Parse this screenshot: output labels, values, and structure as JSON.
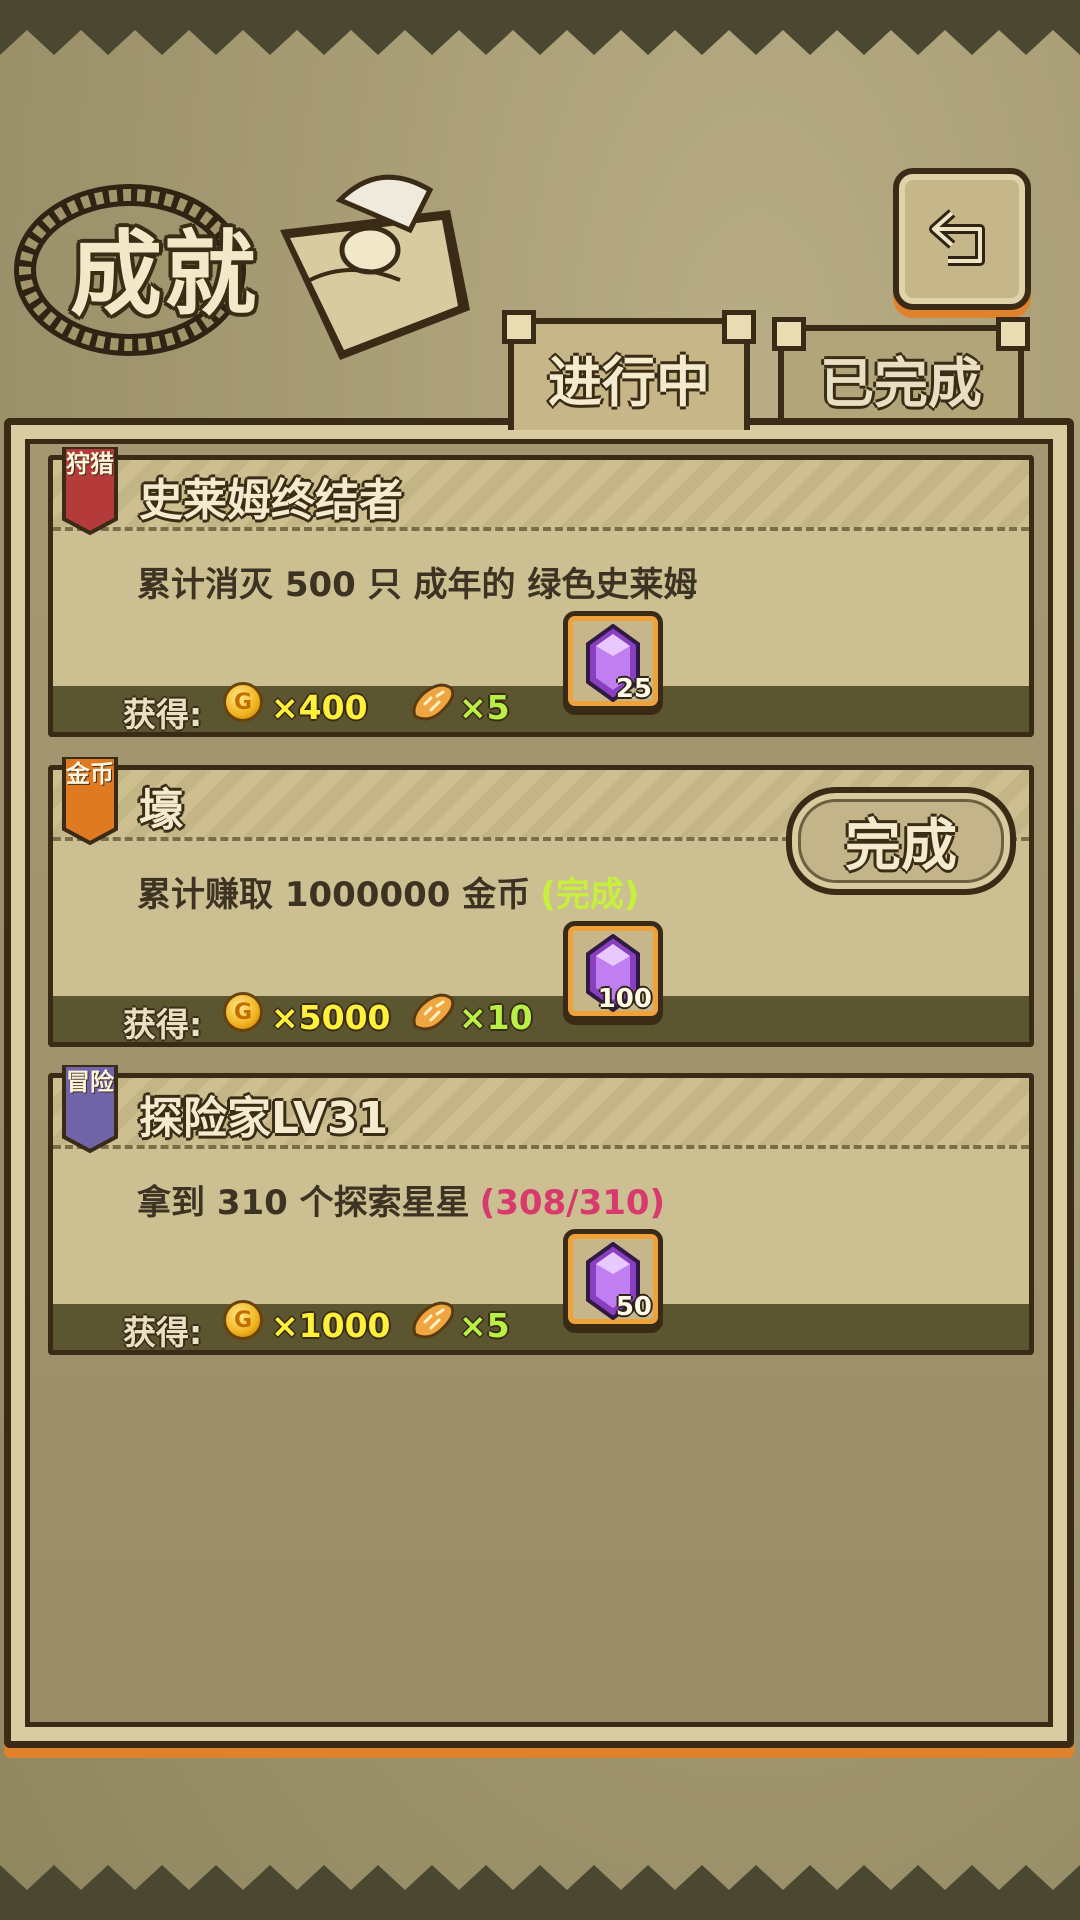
{
  "header": {
    "title": "成就",
    "back_button_label": "back"
  },
  "tabs": [
    {
      "label": "进行中",
      "active": true
    },
    {
      "label": "已完成",
      "active": false
    }
  ],
  "reward_label": "获得:",
  "achievements": [
    {
      "category": "狩猎",
      "category_color": "#b53b3b",
      "title": "史莱姆终结者",
      "description": "累计消灭 500 只 成年的 绿色史莱姆",
      "status_text": "",
      "status_color": "",
      "coins": "×400",
      "bread": "×5",
      "gems": "25"
    },
    {
      "category": "金币",
      "category_color": "#e07a22",
      "title": "壕",
      "description": "累计赚取 1000000 金币",
      "status_text": "(完成)",
      "status_color": "#c6f03a",
      "coins": "×5000",
      "bread": "×10",
      "gems": "100",
      "complete_button": "完成"
    },
    {
      "category": "冒险",
      "category_color": "#6f64a8",
      "title": "探险家LV31",
      "description": "拿到 310 个探索星星",
      "status_text": "(308/310)",
      "status_color": "#d83a6e",
      "coins": "×1000",
      "bread": "×5",
      "gems": "50"
    }
  ],
  "icons": {
    "coin": "coin-icon",
    "bread": "bread-icon",
    "gem": "gem-icon",
    "back": "back-arrow-icon"
  }
}
